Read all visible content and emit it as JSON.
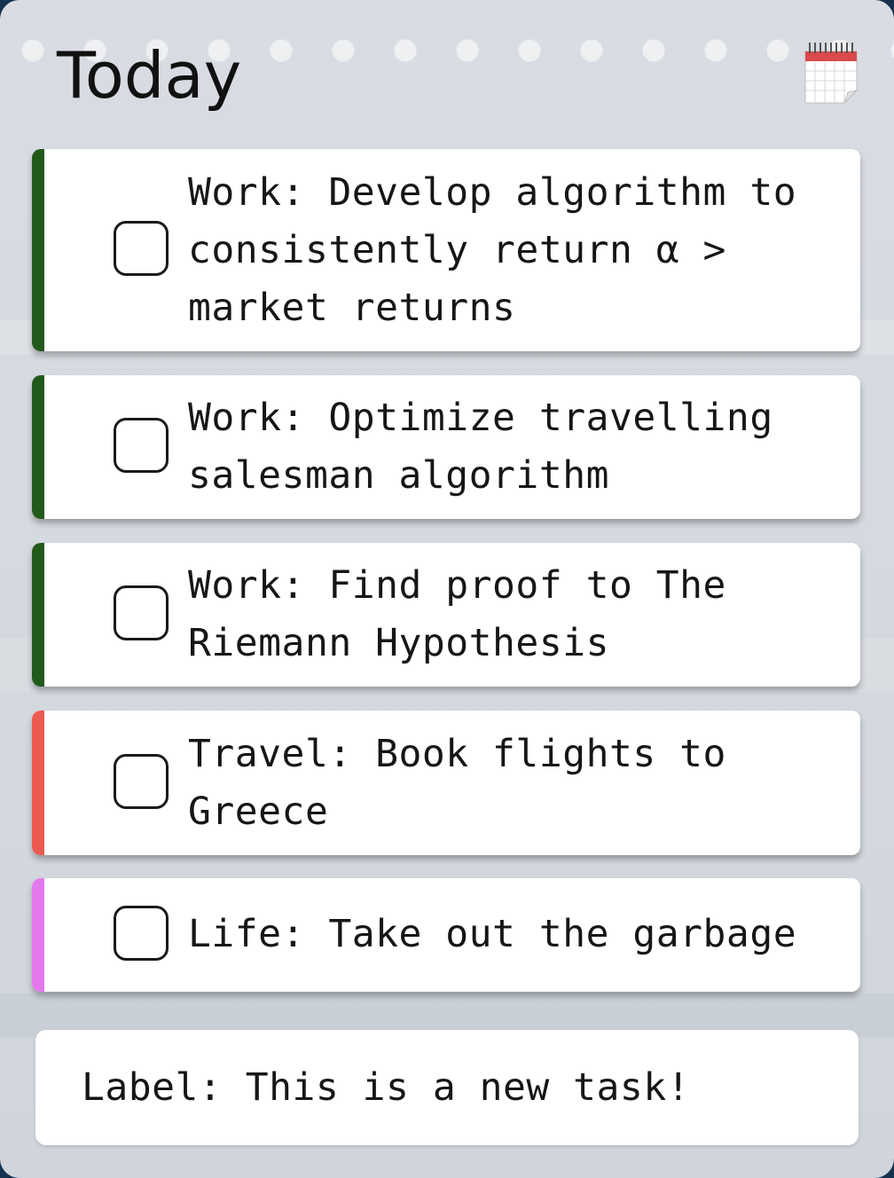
{
  "header": {
    "title": "Today",
    "icon": "calendar-icon"
  },
  "tasks": [
    {
      "text": "Work: Develop algorithm to consistently return α > market returns",
      "color": "#225a1b",
      "checked": false
    },
    {
      "text": "Work: Optimize travelling salesman algorithm",
      "color": "#225a1b",
      "checked": false
    },
    {
      "text": "Work: Find proof to The Riemann Hypothesis",
      "color": "#225a1b",
      "checked": false
    },
    {
      "text": "Travel: Book flights to Greece",
      "color": "#ec5a52",
      "checked": false
    },
    {
      "text": "Life: Take out the garbage",
      "color": "#e478ee",
      "checked": false
    }
  ],
  "new_task": {
    "value": "Label: This is a new task!"
  }
}
